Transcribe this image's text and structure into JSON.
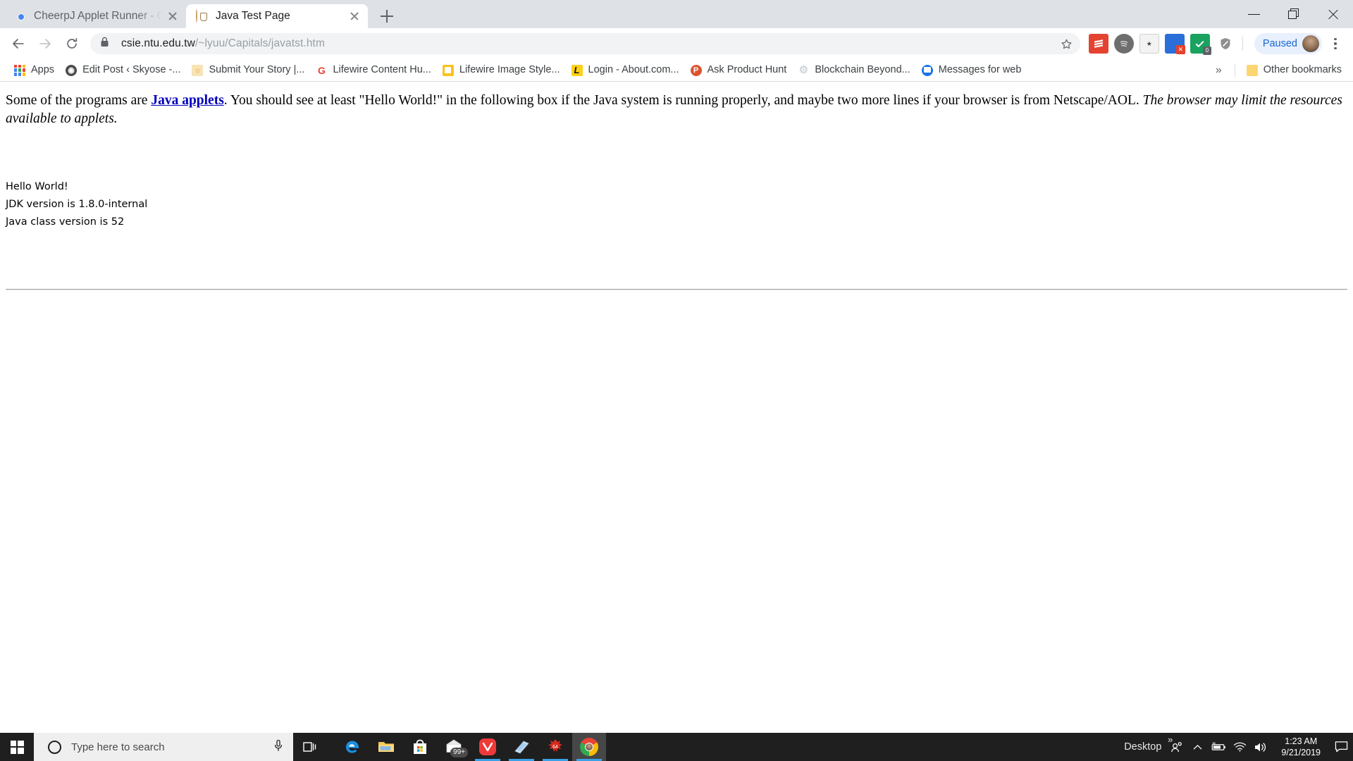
{
  "window": {
    "controls": {
      "minimize": "minimize",
      "maximize": "maximize",
      "close": "close"
    }
  },
  "tabs": [
    {
      "title": "CheerpJ Applet Runner - Chrome",
      "favicon": "chrome-icon",
      "active": false
    },
    {
      "title": "Java Test Page",
      "favicon": "java-icon",
      "active": true
    }
  ],
  "new_tab_label": "+",
  "toolbar": {
    "back": "←",
    "forward": "→",
    "reload": "↻",
    "lock_icon": "lock-icon",
    "url_host": "csie.ntu.edu.tw",
    "url_path": "/~lyuu/Capitals/javatst.htm",
    "url_full": "csie.ntu.edu.tw/~lyuu/Capitals/javatst.htm",
    "star": "☆",
    "profile_label": "Paused",
    "menu": "chrome-menu-icon",
    "extensions": [
      {
        "name": "todoist-extension",
        "color": "#e44332",
        "glyph": "≡"
      },
      {
        "name": "spotify-extension",
        "color": "#6e6e6e",
        "glyph": "♫"
      },
      {
        "name": "evernote-web-clipper-extension",
        "color": "#f5f5f5",
        "glyph": "✱"
      },
      {
        "name": "grammarly-extension",
        "color": "#2a6ed9",
        "glyph": "⚑"
      },
      {
        "name": "lastpass-extension",
        "color": "#1aa260",
        "glyph": "✓"
      },
      {
        "name": "adblock-extension",
        "color": "#8f8f8f",
        "glyph": "⊘"
      }
    ]
  },
  "bookmarks": {
    "apps_label": "Apps",
    "items": [
      {
        "label": "Edit Post ‹ Skyose -...",
        "icon": "globe-icon",
        "color": "#4a4a4a",
        "glyph": "⊕"
      },
      {
        "label": "Submit Your Story |...",
        "icon": "sunrise-icon",
        "color": "#f8d486",
        "glyph": "☀"
      },
      {
        "label": "Lifewire Content Hu...",
        "icon": "google-icon",
        "color": "#ffffff",
        "glyph": "G"
      },
      {
        "label": "Lifewire Image Style...",
        "icon": "yellow-square-icon",
        "color": "#fcc21b",
        "glyph": "□"
      },
      {
        "label": "Login - About.com...",
        "icon": "lifewire-l-icon",
        "color": "#fcd116",
        "glyph": "L"
      },
      {
        "label": "Ask Product Hunt",
        "icon": "product-hunt-icon",
        "color": "#da552f",
        "glyph": "P"
      },
      {
        "label": "Blockchain Beyond...",
        "icon": "gear-icon",
        "color": "#cfd4d8",
        "glyph": "⚙"
      },
      {
        "label": "Messages for web",
        "icon": "messages-icon",
        "color": "#1a73e8",
        "glyph": "▣"
      }
    ],
    "overflow": "»",
    "other_bookmarks_label": "Other bookmarks",
    "other_bookmarks_icon": "folder-icon"
  },
  "page": {
    "paragraph_part1": "Some of the programs are ",
    "link_text": "Java applets",
    "paragraph_part2": ". You should see at least \"Hello World!\" in the following box if the Java system is running properly, and maybe two more lines if your browser is from Netscape/AOL. ",
    "paragraph_emphasis": "The browser may limit the resources available to applets.",
    "applet_lines": [
      "Hello World!",
      "JDK version is 1.8.0-internal",
      "Java class version is 52"
    ]
  },
  "taskbar": {
    "start": "start-button",
    "search_placeholder": "Type here to search",
    "cortana": "cortana-icon",
    "mic": "microphone-icon",
    "task_view": "task-view-icon",
    "apps": [
      {
        "name": "microsoft-edge",
        "glyph": "e",
        "color": "#1a8fe0",
        "running": false,
        "active": false
      },
      {
        "name": "file-explorer",
        "glyph": "🗀",
        "color": "#f5c754",
        "running": false,
        "active": false
      },
      {
        "name": "microsoft-store",
        "glyph": "▦",
        "color": "#ffffff",
        "running": false,
        "active": false
      },
      {
        "name": "mail",
        "glyph": "✉",
        "color": "#ffffff",
        "badge": "99+",
        "running": false,
        "active": false
      },
      {
        "name": "vivaldi-browser",
        "glyph": "V",
        "color": "#ef3939",
        "running": true,
        "active": false
      },
      {
        "name": "photos",
        "glyph": "◧",
        "color": "#cfe3f2",
        "running": true,
        "active": false
      },
      {
        "name": "java-applet-runner",
        "glyph": "64",
        "color": "#d62b1f",
        "running": true,
        "active": false
      },
      {
        "name": "google-chrome",
        "glyph": "●",
        "color": "#ffffff",
        "running": true,
        "active": true
      }
    ],
    "desktop_label": "Desktop",
    "desktop_overflow": "»",
    "tray": [
      {
        "name": "people-icon",
        "glyph": "👤"
      },
      {
        "name": "show-hidden-icons-chevron",
        "glyph": "ⱏ"
      },
      {
        "name": "battery-charging-icon",
        "glyph": "▬"
      },
      {
        "name": "wifi-icon",
        "glyph": "◠"
      },
      {
        "name": "volume-icon",
        "glyph": "🔊"
      }
    ],
    "clock_time": "1:23 AM",
    "clock_date": "9/21/2019",
    "action_center": "action-center-icon"
  }
}
